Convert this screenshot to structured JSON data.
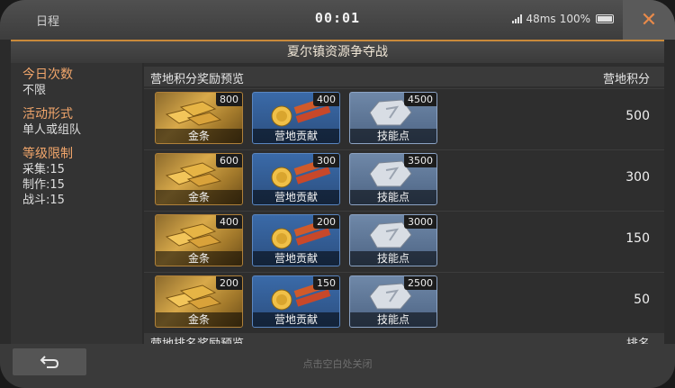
{
  "statusbar": {
    "left_label": "日程",
    "time": "00:01",
    "ping": "48ms",
    "battery": "100%"
  },
  "title": "夏尔镇资源争夺战",
  "left_panel": {
    "daily_times": {
      "label": "今日次数",
      "value": "不限"
    },
    "activity_form": {
      "label": "活动形式",
      "value": "单人或组队"
    },
    "level_limit": {
      "label": "等级限制",
      "lines": [
        "采集:15",
        "制作:15",
        "战斗:15"
      ]
    }
  },
  "list": {
    "header_left": "营地积分奖励预览",
    "header_right": "营地积分",
    "rows": [
      {
        "items": [
          {
            "name": "金条",
            "qty": "800"
          },
          {
            "name": "营地贡献",
            "qty": "400"
          },
          {
            "name": "技能点",
            "qty": "4500"
          }
        ],
        "score": "500"
      },
      {
        "items": [
          {
            "name": "金条",
            "qty": "600"
          },
          {
            "name": "营地贡献",
            "qty": "300"
          },
          {
            "name": "技能点",
            "qty": "3500"
          }
        ],
        "score": "300"
      },
      {
        "items": [
          {
            "name": "金条",
            "qty": "400"
          },
          {
            "name": "营地贡献",
            "qty": "200"
          },
          {
            "name": "技能点",
            "qty": "3000"
          }
        ],
        "score": "150"
      },
      {
        "items": [
          {
            "name": "金条",
            "qty": "200"
          },
          {
            "name": "营地贡献",
            "qty": "150"
          },
          {
            "name": "技能点",
            "qty": "2500"
          }
        ],
        "score": "50"
      }
    ],
    "footer_left": "营地排名奖励预览",
    "footer_right": "排名"
  },
  "bottom": {
    "hint": "点击空白处关闭"
  },
  "colors": {
    "accent": "#e88a4a",
    "label_orange": "#f2a66b",
    "title_border": "#c98a3a"
  }
}
